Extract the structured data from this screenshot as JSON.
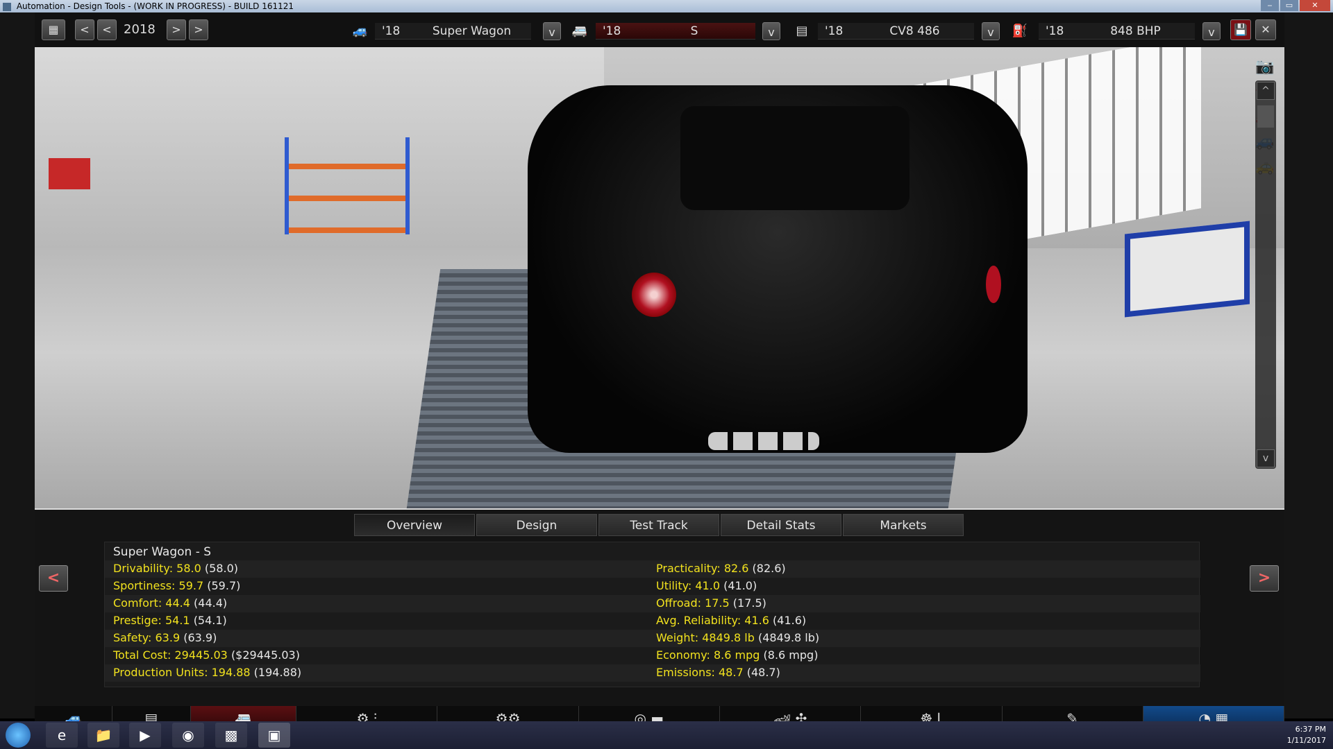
{
  "window": {
    "title": "Automation - Design Tools - (WORK IN PROGRESS) - BUILD 161121"
  },
  "toolbar": {
    "year": "2018",
    "model": {
      "year": "'18",
      "name": "Super Wagon"
    },
    "trim": {
      "year": "'18",
      "name": "S"
    },
    "engine_family": {
      "year": "'18",
      "name": "CV8 486"
    },
    "engine_variant": {
      "year": "'18",
      "name": "848 BHP"
    }
  },
  "tabs": [
    "Overview",
    "Design",
    "Test Track",
    "Detail Stats",
    "Markets"
  ],
  "active_tab": "Overview",
  "overview": {
    "heading": "Super Wagon - S",
    "left": [
      {
        "label": "Drivability: 58.0",
        "paren": "(58.0)"
      },
      {
        "label": "Sportiness: 59.7",
        "paren": "(59.7)"
      },
      {
        "label": "Comfort: 44.4",
        "paren": "(44.4)"
      },
      {
        "label": "Prestige: 54.1",
        "paren": "(54.1)"
      },
      {
        "label": "Safety: 63.9",
        "paren": "(63.9)"
      },
      {
        "label": "Total Cost: 29445.03",
        "paren": "($29445.03)"
      },
      {
        "label": "Production Units: 194.88",
        "paren": "(194.88)"
      }
    ],
    "right": [
      {
        "label": "Practicality: 82.6",
        "paren": "(82.6)"
      },
      {
        "label": "Utility: 41.0",
        "paren": "(41.0)"
      },
      {
        "label": "Offroad: 17.5",
        "paren": "(17.5)"
      },
      {
        "label": "Avg. Reliability: 41.6",
        "paren": "(41.6)"
      },
      {
        "label": "Weight: 4849.8 lb",
        "paren": "(4849.8 lb)"
      },
      {
        "label": "Economy: 8.6 mpg",
        "paren": "(8.6 mpg)"
      },
      {
        "label": "Emissions: 48.7",
        "paren": "(48.7)"
      }
    ]
  },
  "taskbar": {
    "time": "6:37 PM",
    "date": "1/11/2017"
  },
  "colors": {
    "stat_label": "#f2e21e",
    "accent_red": "#b01020"
  }
}
